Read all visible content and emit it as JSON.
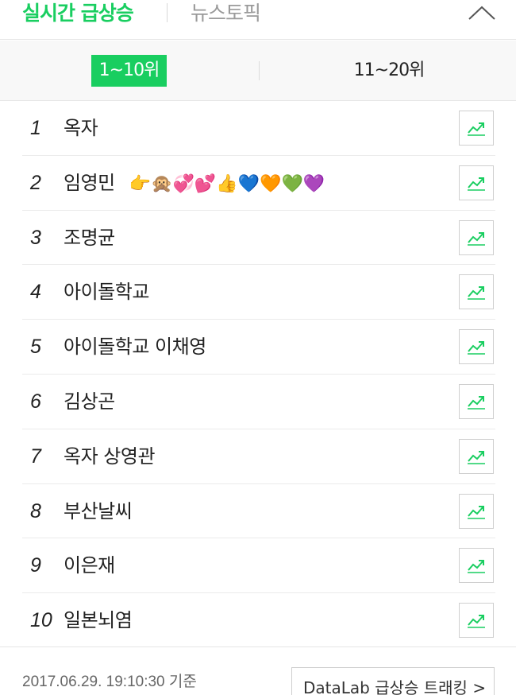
{
  "tabs": {
    "active": "실시간 급상승",
    "inactive": "뉴스토픽"
  },
  "icons": {
    "collapse": "chevron-up-icon",
    "trend": "trend-chart-icon"
  },
  "range": {
    "active": "1~10위",
    "inactive": "11~20위"
  },
  "items": [
    {
      "rank": "1",
      "term": "옥자",
      "emoji": ""
    },
    {
      "rank": "2",
      "term": "임영민",
      "emoji": "👉🙊💞💕👍💙🧡💚💜"
    },
    {
      "rank": "3",
      "term": "조명균",
      "emoji": ""
    },
    {
      "rank": "4",
      "term": "아이돌학교",
      "emoji": ""
    },
    {
      "rank": "5",
      "term": "아이돌학교 이채영",
      "emoji": ""
    },
    {
      "rank": "6",
      "term": "김상곤",
      "emoji": ""
    },
    {
      "rank": "7",
      "term": "옥자 상영관",
      "emoji": ""
    },
    {
      "rank": "8",
      "term": "부산날씨",
      "emoji": ""
    },
    {
      "rank": "9",
      "term": "이은재",
      "emoji": ""
    },
    {
      "rank": "10",
      "term": "일본뇌염",
      "emoji": ""
    }
  ],
  "footer": {
    "timestamp": "2017.06.29. 19:10:30 기준",
    "datalab_link": "DataLab 급상승 트래킹 >"
  },
  "colors": {
    "accent": "#19ce60",
    "text": "#222222",
    "muted": "#9a9a9a"
  }
}
